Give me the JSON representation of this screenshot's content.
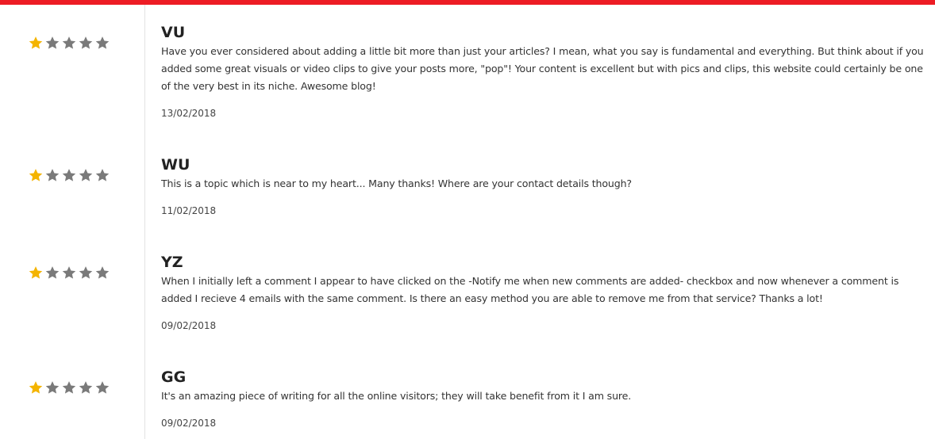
{
  "colors": {
    "accent_bar": "#ed1c24",
    "star_filled": "#f4b400",
    "star_empty": "#7a7a7a"
  },
  "reviews": [
    {
      "name": "VU",
      "rating": 1,
      "max_rating": 5,
      "text": "Have you ever considered about adding a little bit more than just your articles? I mean, what you say is fundamental and everything. But think about if you added some great visuals or video clips to give your posts more, \"pop\"! Your content is excellent but with pics and clips, this website could certainly be one of the very best in its niche. Awesome blog!",
      "date": "13/02/2018"
    },
    {
      "name": "WU",
      "rating": 1,
      "max_rating": 5,
      "text": "This is a topic which is near to my heart... Many thanks! Where are your contact details though?",
      "date": "11/02/2018"
    },
    {
      "name": "YZ",
      "rating": 1,
      "max_rating": 5,
      "text": "When I initially left a comment I appear to have clicked on the -Notify me when new comments are added- checkbox and now whenever a comment is added I recieve 4 emails with the same comment. Is there an easy method you are able to remove me from that service? Thanks a lot!",
      "date": "09/02/2018"
    },
    {
      "name": "GG",
      "rating": 1,
      "max_rating": 5,
      "text": "It's an amazing piece of writing for all the online visitors; they will take benefit from it I am sure.",
      "date": "09/02/2018"
    }
  ]
}
